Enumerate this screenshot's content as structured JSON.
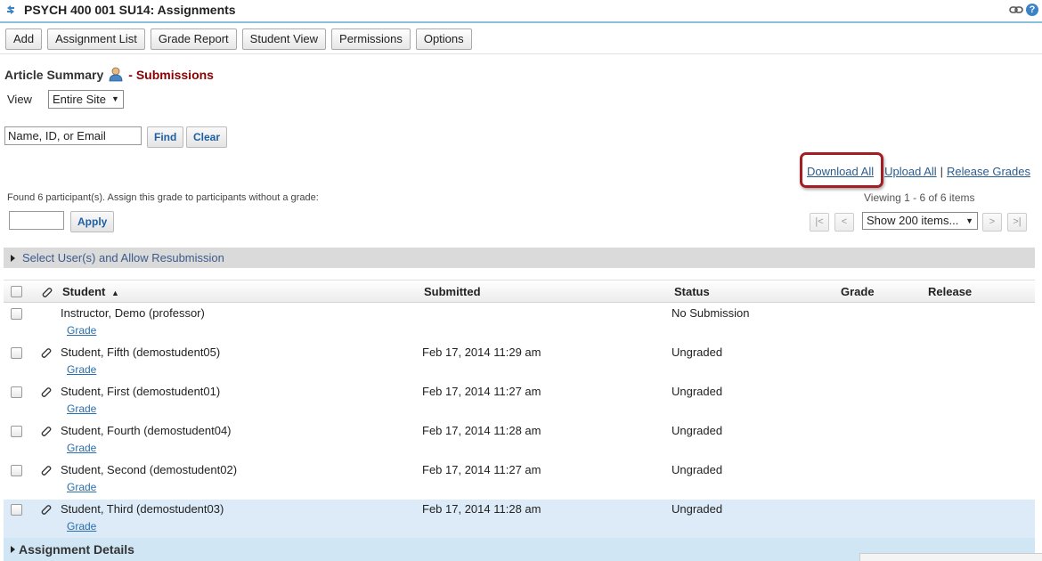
{
  "header": {
    "title": "PSYCH 400 001 SU14: Assignments",
    "link_icon": "link-icon",
    "help_icon": "help-icon",
    "help_glyph": "?"
  },
  "toolbar": {
    "buttons": [
      "Add",
      "Assignment List",
      "Grade Report",
      "Student View",
      "Permissions",
      "Options"
    ]
  },
  "page": {
    "heading": "Article Summary",
    "heading_sub": "- Submissions"
  },
  "view": {
    "label": "View",
    "selected": "Entire Site"
  },
  "search": {
    "value": "Name, ID, or Email",
    "find_label": "Find",
    "clear_label": "Clear"
  },
  "actions": {
    "download_all": "Download All",
    "upload_all": "Upload All",
    "separator": "|",
    "release_grades": "Release Grades"
  },
  "assign_grade": {
    "found_text": "Found 6 participant(s). Assign this grade to participants without a grade:",
    "value": "",
    "apply_label": "Apply"
  },
  "pager": {
    "viewing": "Viewing 1 - 6 of 6 items",
    "first": "|<",
    "prev": "<",
    "next": ">",
    "last": ">|",
    "page_size": "Show 200 items..."
  },
  "resubmission": {
    "label": "Select User(s) and Allow Resubmission"
  },
  "table": {
    "columns": {
      "student": "Student",
      "submitted": "Submitted",
      "status": "Status",
      "grade": "Grade",
      "release": "Release"
    },
    "sort_indicator": "▲",
    "grade_link": "Grade",
    "rows": [
      {
        "student": "Instructor, Demo (professor)",
        "submitted": "",
        "status": "No Submission",
        "attachment": false
      },
      {
        "student": "Student, Fifth (demostudent05)",
        "submitted": "Feb 17, 2014 11:29 am",
        "status": "Ungraded",
        "attachment": true
      },
      {
        "student": "Student, First (demostudent01)",
        "submitted": "Feb 17, 2014 11:27 am",
        "status": "Ungraded",
        "attachment": true
      },
      {
        "student": "Student, Fourth (demostudent04)",
        "submitted": "Feb 17, 2014 11:28 am",
        "status": "Ungraded",
        "attachment": true
      },
      {
        "student": "Student, Second (demostudent02)",
        "submitted": "Feb 17, 2014 11:27 am",
        "status": "Ungraded",
        "attachment": true
      },
      {
        "student": "Student, Third (demostudent03)",
        "submitted": "Feb 17, 2014 11:28 am",
        "status": "Ungraded",
        "attachment": true
      }
    ]
  },
  "details": {
    "label": "Assignment Details"
  },
  "colors": {
    "accent_blue": "#8bbfe0",
    "heading_red": "#8b0000",
    "highlight_box": "#a31d24",
    "row_highlight": "#dcebf7"
  }
}
